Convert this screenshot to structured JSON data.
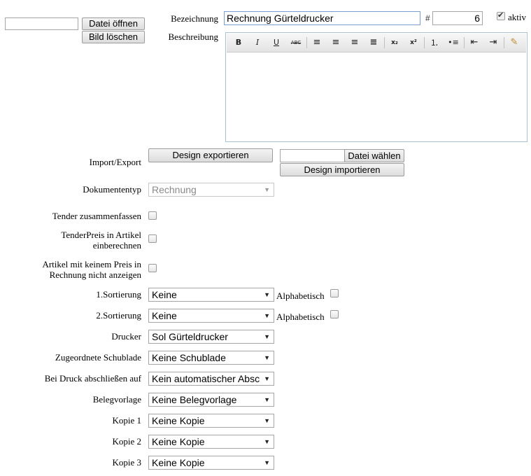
{
  "image": {
    "file_input_value": "",
    "open_label": "Datei öffnen",
    "delete_label": "Bild löschen"
  },
  "name": {
    "label": "Bezeichnung",
    "value": "Rechnung Gürteldrucker"
  },
  "number": {
    "hash": "#",
    "value": "6"
  },
  "active": {
    "label": "aktiv",
    "checked": true
  },
  "description": {
    "label": "Beschreibung",
    "toolbar": [
      {
        "name": "bold-icon",
        "glyph": "B"
      },
      {
        "name": "italic-icon",
        "glyph": "I"
      },
      {
        "name": "underline-icon",
        "glyph": "U"
      },
      {
        "name": "strikethrough-icon",
        "glyph": "ABC"
      },
      {
        "name": "align-left-icon",
        "glyph": "≡"
      },
      {
        "name": "align-center-icon",
        "glyph": "≡"
      },
      {
        "name": "align-right-icon",
        "glyph": "≡"
      },
      {
        "name": "align-justify-icon",
        "glyph": "≡"
      },
      {
        "name": "subscript-icon",
        "glyph": "x₂"
      },
      {
        "name": "superscript-icon",
        "glyph": "x²"
      },
      {
        "name": "ordered-list-icon",
        "glyph": "⒈"
      },
      {
        "name": "unordered-list-icon",
        "glyph": "•≡"
      },
      {
        "name": "outdent-icon",
        "glyph": "⇤"
      },
      {
        "name": "indent-icon",
        "glyph": "⇥"
      },
      {
        "name": "clear-format-icon",
        "glyph": "✎"
      }
    ]
  },
  "import_export": {
    "label": "Import/Export",
    "export_label": "Design exportieren",
    "choose_file_label": "Datei wählen",
    "import_label": "Design importieren"
  },
  "document_type": {
    "label": "Dokumententyp",
    "value": "Rechnung"
  },
  "tender_combine": {
    "label": "Tender zusammenfassen",
    "checked": false
  },
  "tender_price": {
    "label_line1": "TenderPreis in Artikel",
    "label_line2": "einberechnen",
    "checked": false
  },
  "hide_no_price": {
    "label_line1": "Artikel mit keinem Preis in",
    "label_line2": "Rechnung nicht anzeigen",
    "checked": false
  },
  "sort1": {
    "label": "1.Sortierung",
    "value": "Keine",
    "alpha_label": "Alphabetisch",
    "alpha_checked": false
  },
  "sort2": {
    "label": "2.Sortierung",
    "value": "Keine",
    "alpha_label": "Alphabetisch",
    "alpha_checked": false
  },
  "printer": {
    "label": "Drucker",
    "value": "Sol Gürteldrucker"
  },
  "drawer": {
    "label": "Zugeordnete Schublade",
    "value": "Keine Schublade"
  },
  "close_on_print": {
    "label": "Bei Druck abschließen auf",
    "value": "Kein automatischer Abschluss"
  },
  "receipt_template": {
    "label": "Belegvorlage",
    "value": "Keine Belegvorlage"
  },
  "copy1": {
    "label": "Kopie 1",
    "value": "Keine Kopie"
  },
  "copy2": {
    "label": "Kopie 2",
    "value": "Keine Kopie"
  },
  "copy3": {
    "label": "Kopie 3",
    "value": "Keine Kopie"
  },
  "colors": {
    "editor_border": "#a9c1d6",
    "focus_border": "#7a9cd3"
  }
}
